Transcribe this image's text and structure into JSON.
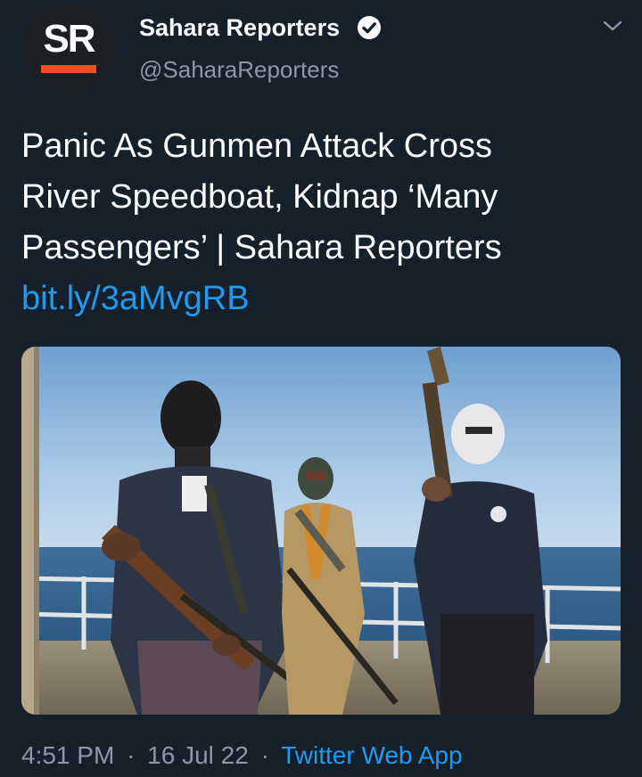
{
  "account": {
    "avatar_text": "SR",
    "display_name": "Sahara Reporters",
    "handle": "@SaharaReporters",
    "verified_icon": "verified-badge-icon",
    "menu_icon": "chevron-down-icon"
  },
  "tweet": {
    "text_lines": [
      "Panic As Gunmen Attack Cross",
      "River Speedboat, Kidnap ‘Many",
      "Passengers’ | Sahara Reporters"
    ],
    "link": "bit.ly/3aMvgRB"
  },
  "media": {
    "type": "photo"
  },
  "meta": {
    "time": "4:51 PM",
    "separator": "·",
    "date": "16 Jul 22",
    "source": "Twitter Web App"
  },
  "colors": {
    "background": "#15202b",
    "link": "#1d9bf0",
    "secondary_text": "#8b98a5",
    "brand_accent": "#f04e23"
  }
}
